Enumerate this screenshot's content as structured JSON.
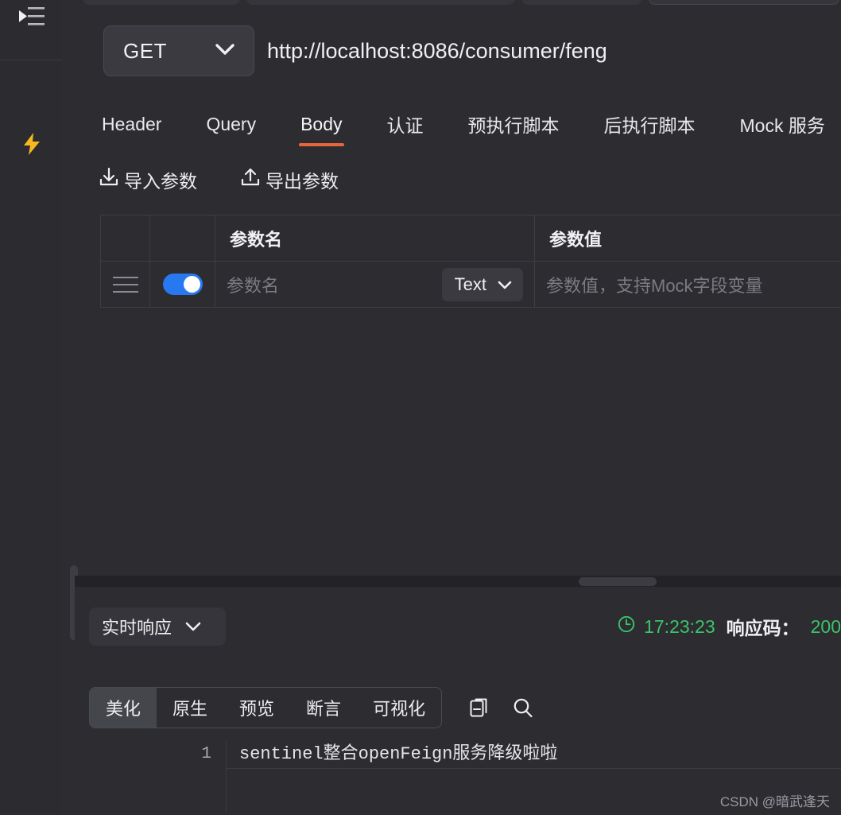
{
  "sidebar": {
    "menu_icon": "collapse-menu-icon",
    "bolt_icon": "lightning-bolt-icon"
  },
  "request": {
    "method": "GET",
    "method_icon": "chevron-down-icon",
    "url": "http://localhost:8086/consumer/feng"
  },
  "tabs": [
    {
      "label": "Header",
      "active": false
    },
    {
      "label": "Query",
      "active": false
    },
    {
      "label": "Body",
      "active": true
    },
    {
      "label": "认证",
      "active": false
    },
    {
      "label": "预执行脚本",
      "active": false
    },
    {
      "label": "后执行脚本",
      "active": false
    },
    {
      "label": "Mock 服务",
      "active": false
    }
  ],
  "accent_color": "#e8653a",
  "actions": {
    "import_label": "导入参数",
    "import_icon": "download-icon",
    "export_label": "导出参数",
    "export_icon": "upload-icon"
  },
  "param_table": {
    "headers": [
      "",
      "",
      "参数名",
      "参数值"
    ],
    "rows": [
      {
        "drag_icon": "drag-handle-icon",
        "enabled": true,
        "name_value": "",
        "name_placeholder": "参数名",
        "type": "Text",
        "type_icon": "chevron-down-icon",
        "value": "",
        "value_placeholder": "参数值，支持Mock字段变量"
      }
    ]
  },
  "response": {
    "mode_label": "实时响应",
    "mode_icon": "chevron-down-icon",
    "clock_icon": "clock-icon",
    "time": "17:23:23",
    "code_label": "响应码：",
    "code_value": "200",
    "status_color": "#3cc46a",
    "view_tabs": [
      {
        "label": "美化",
        "active": true
      },
      {
        "label": "原生",
        "active": false
      },
      {
        "label": "预览",
        "active": false
      },
      {
        "label": "断言",
        "active": false
      },
      {
        "label": "可视化",
        "active": false
      }
    ],
    "copy_icon": "copy-icon",
    "search_icon": "search-icon",
    "body_lines": [
      {
        "number": "1",
        "text": "sentinel整合openFeign服务降级啦啦"
      }
    ]
  },
  "watermark": "CSDN @暗武逢天"
}
